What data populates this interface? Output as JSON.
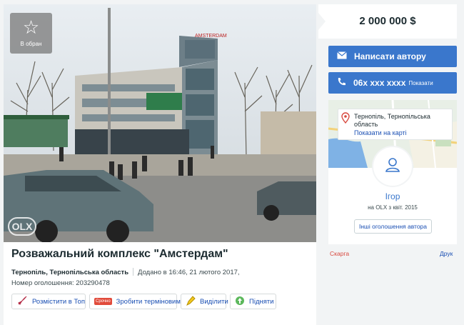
{
  "favorite": {
    "label": "В обран",
    "icon": "star-icon"
  },
  "watermark": "OLX",
  "listing": {
    "title": "Розважальний комплекс \"Амстердам\"",
    "location": "Тернопіль, Тернопільська область",
    "added": "Додано в 16:46, 21 лютого 2017,",
    "ad_number": "Номер оголошення: 203290478"
  },
  "promotions": [
    {
      "label": "Розмістити в Топ",
      "icon": "rocket-icon"
    },
    {
      "label": "Зробити терміновим",
      "icon": "urgent-badge-icon",
      "badge": "Срочно"
    },
    {
      "label": "Виділити",
      "icon": "marker-icon"
    },
    {
      "label": "Підняти",
      "icon": "up-arrow-icon"
    }
  ],
  "price": "2 000 000 $",
  "actions": {
    "message_label": "Написати автору",
    "phone_label": "06x xxx xxxx",
    "phone_show": "Показати"
  },
  "seller": {
    "location_text": "Тернопіль, Тернопільська область",
    "map_link": "Показати на карті",
    "name": "Ігор",
    "since": "на OLX з квіт. 2015",
    "other_ads": "Інші оголошення автора"
  },
  "footer": {
    "complain": "Скарга",
    "print": "Друк"
  },
  "colors": {
    "accent": "#3a77cc",
    "complain": "#d8493f",
    "link": "#1a4fb3"
  }
}
